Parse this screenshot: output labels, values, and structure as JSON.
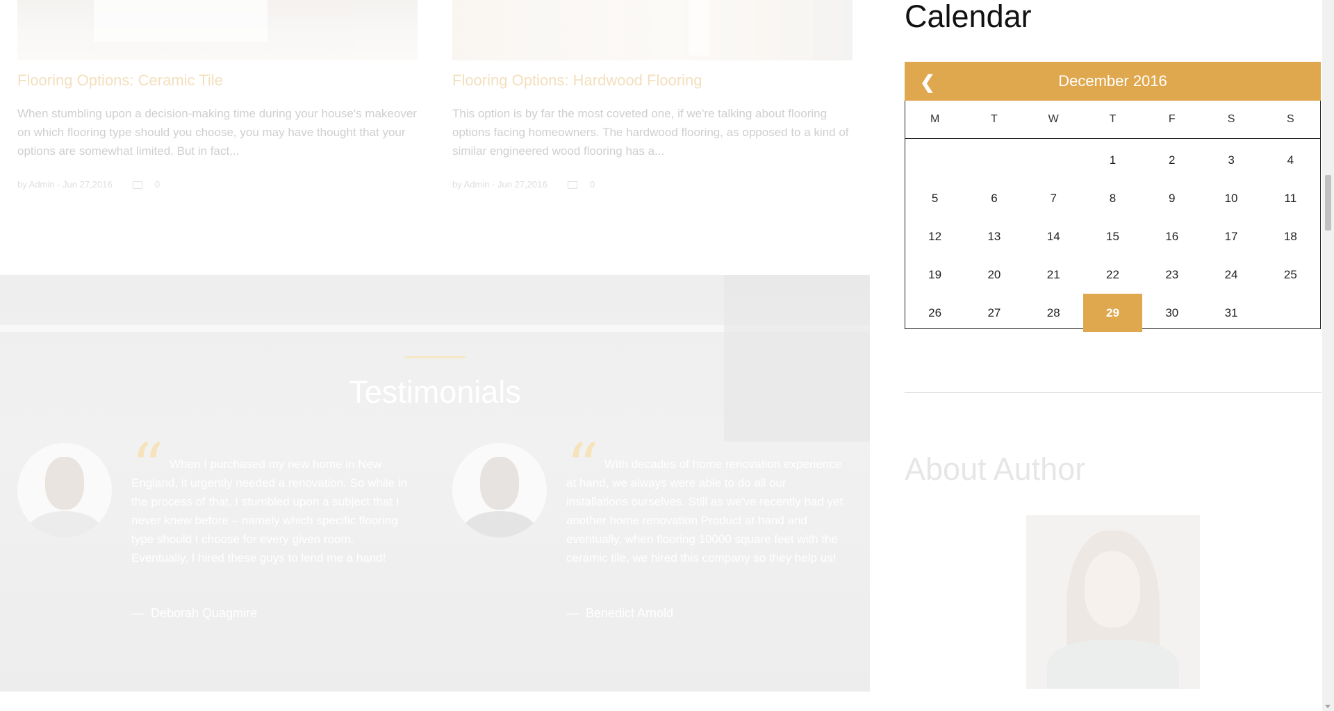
{
  "posts": [
    {
      "title": "Flooring Options: Ceramic Tile",
      "excerpt": "When stumbling upon a decision-making time during your house's makeover on which flooring type should you choose, you may have thought that your options are somewhat limited. But in fact...",
      "meta": "by Admin - Jun 27,2016",
      "comments": "0"
    },
    {
      "title": "Flooring Options: Hardwood Flooring",
      "excerpt": "This option is by far the most coveted one, if we're talking about flooring options facing homeowners. The hardwood flooring, as opposed to a kind of similar engineered wood flooring has a...",
      "meta": "by Admin - Jun 27,2016",
      "comments": "0"
    }
  ],
  "testimonials": {
    "heading": "Testimonials",
    "items": [
      {
        "text": "When I purchased my new home in New England, it urgently needed a renovation. So while in the process of that, I stumbled upon a subject that I never knew before – namely which specific flooring type should I choose for every given room. Eventually, I hired these guys to lend me a hand!",
        "author": "Deborah Quagmire"
      },
      {
        "text": "With decades of home renovation experience at hand, we always were able to do all our installations ourselves. Still as we've recently had yet another home renovation Product at hand and eventually, when flooring 10000 square feet with the ceramic tile, we hired this company so they help us!",
        "author": "Benedict Arnold"
      }
    ]
  },
  "sidebar": {
    "calendar": {
      "title": "Calendar",
      "month": "December 2016",
      "weekdays": [
        "M",
        "T",
        "W",
        "T",
        "F",
        "S",
        "S"
      ],
      "leading_blanks": 3,
      "days": [
        "1",
        "2",
        "3",
        "4",
        "5",
        "6",
        "7",
        "8",
        "9",
        "10",
        "11",
        "12",
        "13",
        "14",
        "15",
        "16",
        "17",
        "18",
        "19",
        "20",
        "21",
        "22",
        "23",
        "24",
        "25",
        "26",
        "27",
        "28",
        "29",
        "30",
        "31"
      ],
      "today": "29",
      "accent_color": "#e0a84e"
    },
    "about_title": "About Author"
  },
  "colors": {
    "accent": "#e0a84e",
    "post_title": "#f3dfbd"
  },
  "icons": {
    "prev": "chevron-left-icon",
    "comment": "comment-icon",
    "quote": "quote-icon"
  }
}
